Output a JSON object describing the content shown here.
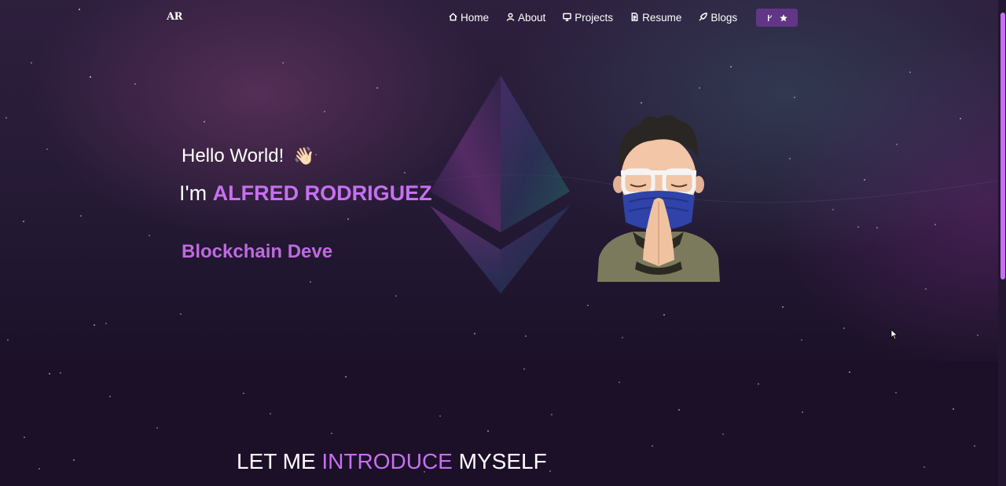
{
  "colors": {
    "accent": "#c770f0",
    "button_bg": "#623686",
    "bg_dark": "#1c1029"
  },
  "nav": {
    "logo": "AR",
    "items": [
      {
        "label": "Home",
        "icon": "home-icon"
      },
      {
        "label": "About",
        "icon": "user-icon"
      },
      {
        "label": "Projects",
        "icon": "projects-icon"
      },
      {
        "label": "Resume",
        "icon": "document-icon"
      },
      {
        "label": "Blogs",
        "icon": "blog-icon"
      }
    ],
    "github_star": {
      "icons": [
        "git-fork-icon",
        "star-icon"
      ]
    }
  },
  "hero": {
    "greeting": "Hello World!",
    "wave_emoji": "👋🏻",
    "im": "I'm ",
    "name": "ALFRED RODRIGUEZ",
    "typewriter": "Blockchain Deve"
  },
  "intro": {
    "part1": "LET ME ",
    "part2": "INTRODUCE",
    "part3": " MYSELF"
  }
}
